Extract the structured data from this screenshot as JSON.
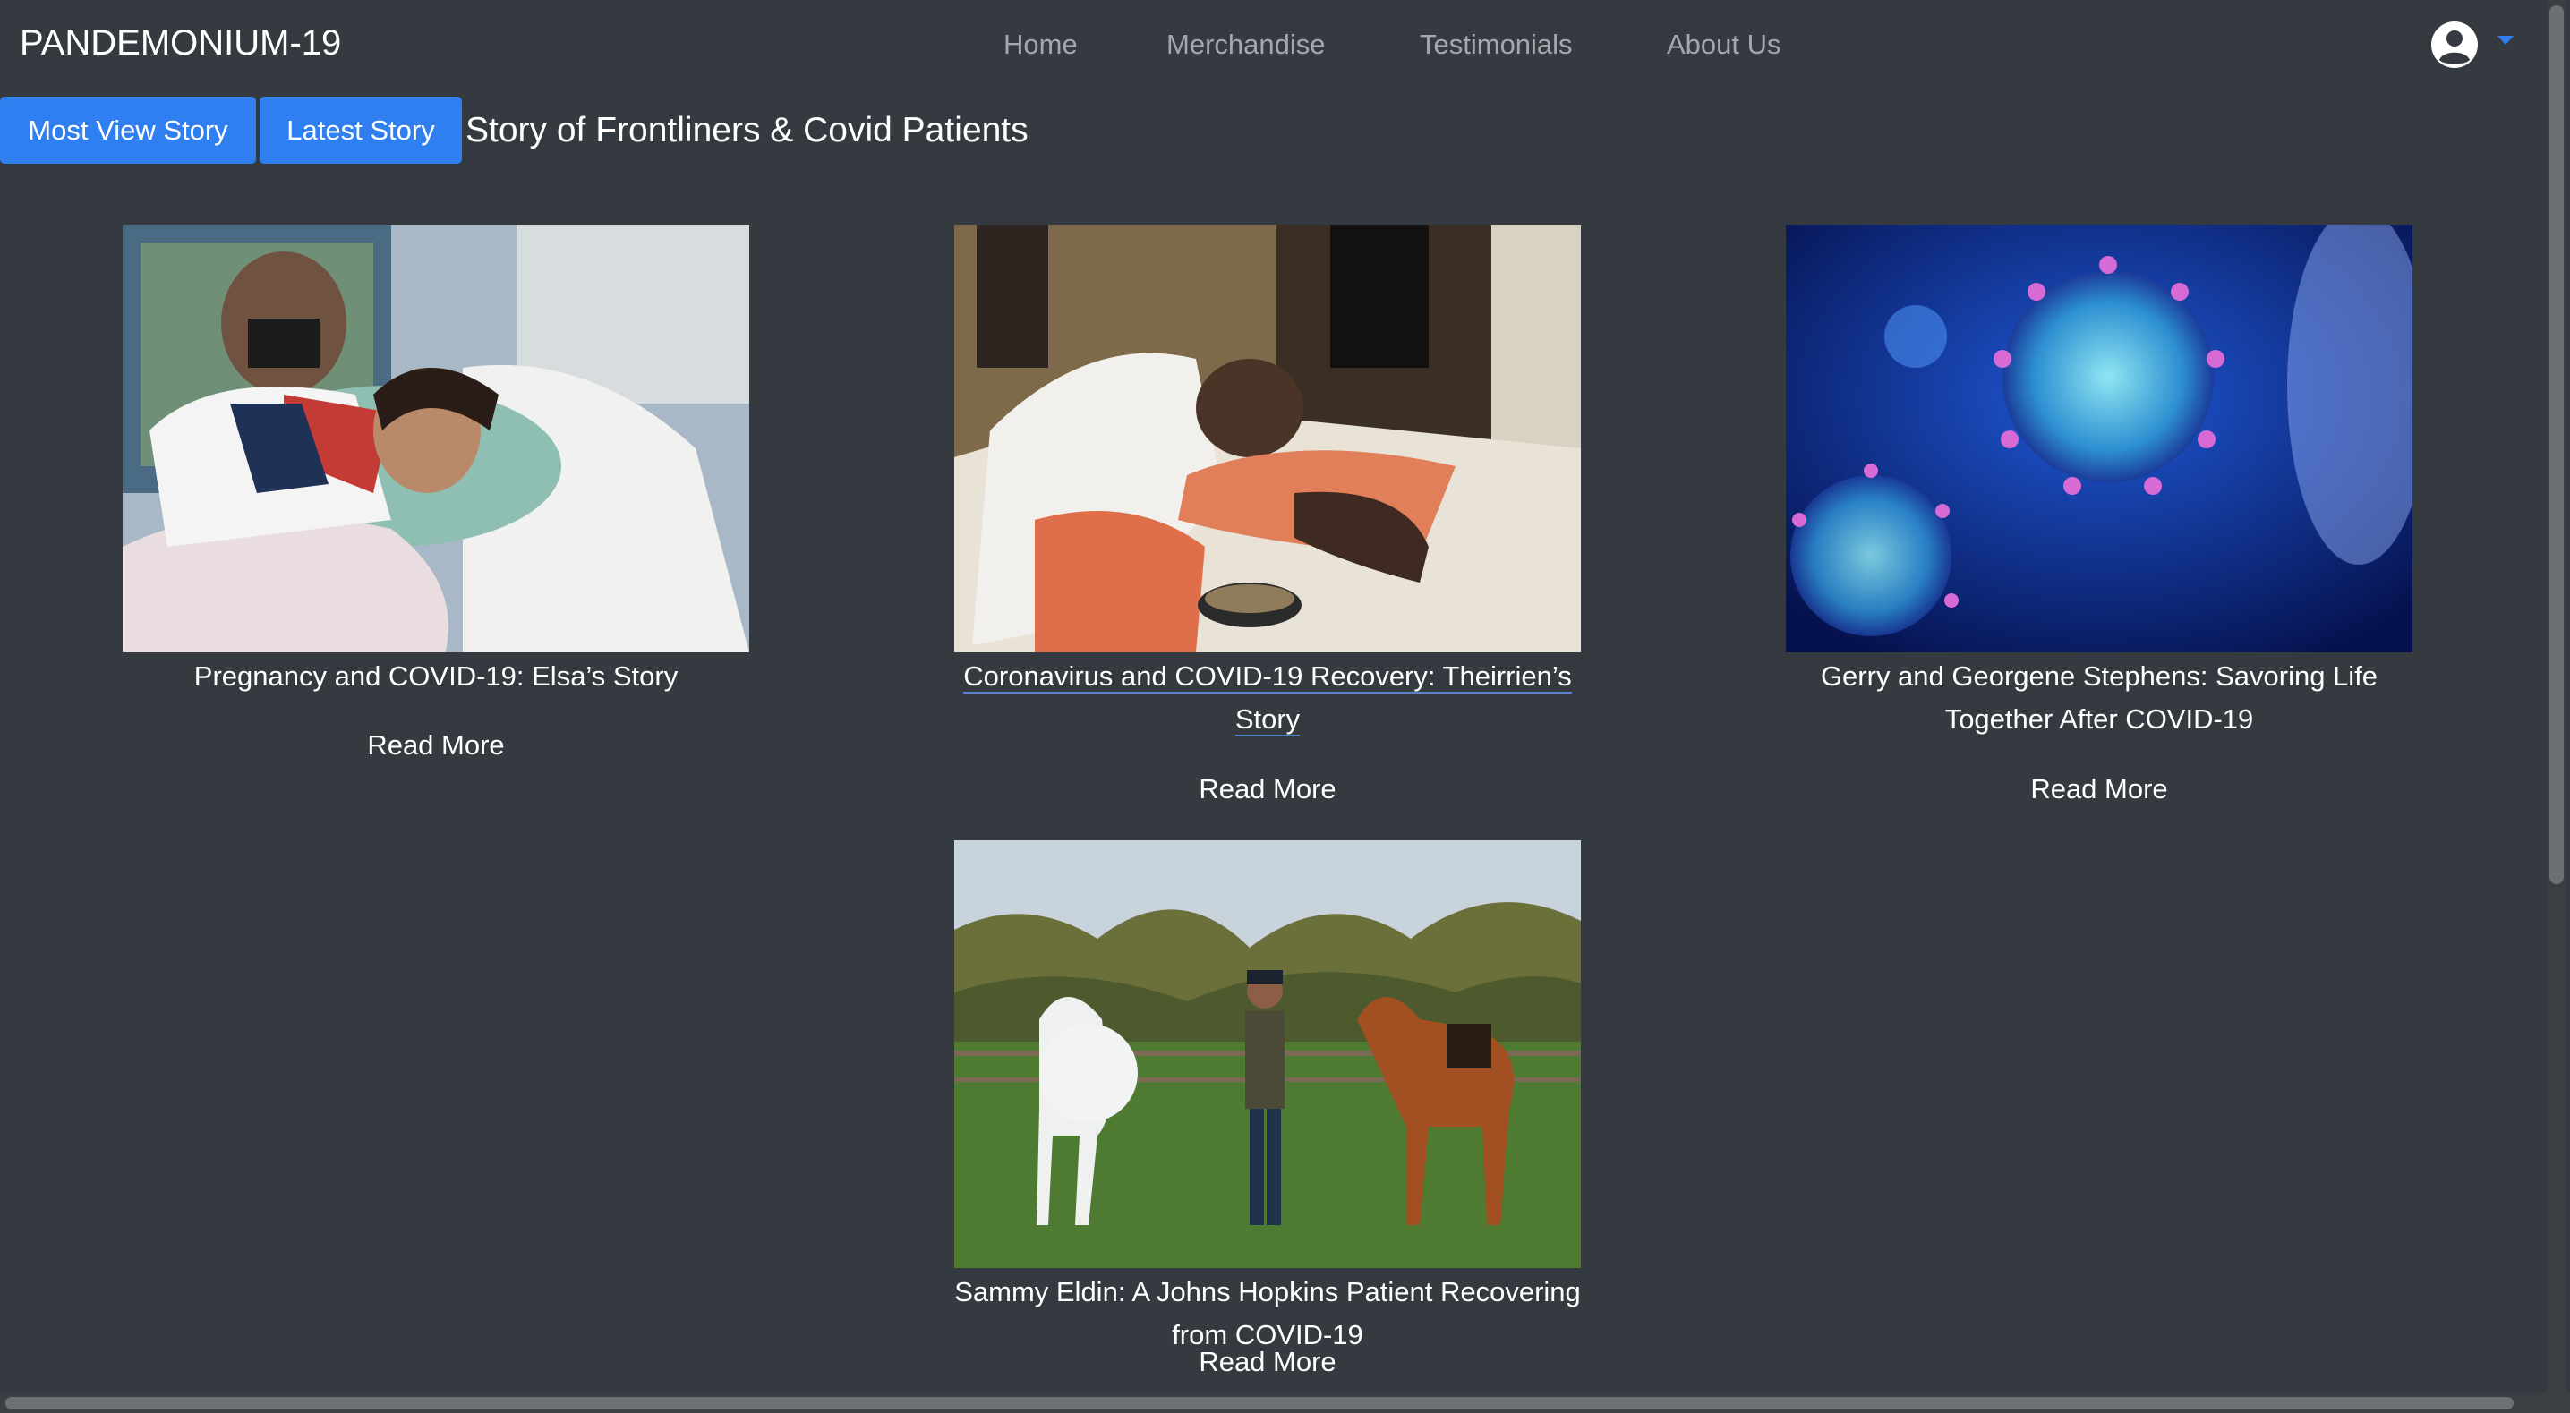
{
  "navbar": {
    "brand": "PANDEMONIUM-19",
    "links": [
      "Home",
      "Merchandise",
      "Testimonials",
      "About Us"
    ]
  },
  "toolbar": {
    "most_view_label": "Most View Story",
    "latest_label": "Latest Story",
    "heading": "Story of Frontliners & Covid Patients"
  },
  "stories": [
    {
      "title": "Pregnancy and COVID-19: Elsa’s Story",
      "read_more": "Read More"
    },
    {
      "title_line1": "Coronavirus and COVID-19 Recovery: Theirrien’s",
      "title_line2": "Story",
      "read_more": "Read More"
    },
    {
      "title_line1": "Gerry and Georgene Stephens: Savoring Life",
      "title_line2": "Together After COVID-19",
      "read_more": "Read More"
    },
    {
      "title": "Sammy Eldin: A Johns Hopkins Patient Recovering from COVID-19",
      "read_more": "Read More"
    }
  ],
  "icons": {
    "account": "user-circle-icon",
    "dropdown": "caret-down-icon"
  },
  "colors": {
    "background": "#343a40",
    "primary": "#2f7ff0",
    "nav_link": "#a4a8ad"
  }
}
